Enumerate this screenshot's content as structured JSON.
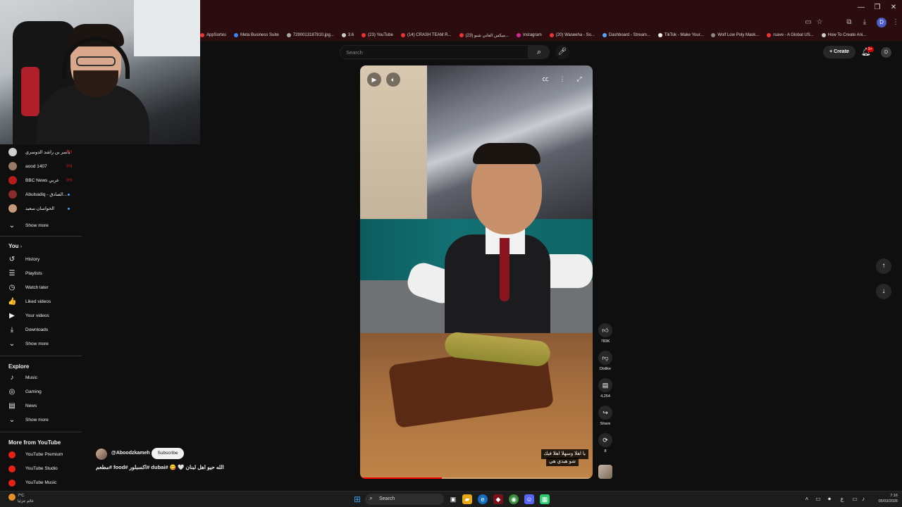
{
  "browser": {
    "bookmarks": [
      {
        "label": "AppSortes",
        "color": "#e33"
      },
      {
        "label": "Meta Business Suite",
        "color": "#3b82f6"
      },
      {
        "label": "7290013187810.jpg...",
        "color": "#aaa"
      },
      {
        "label": "3.6",
        "color": "#ccc"
      },
      {
        "label": "(23) YouTube",
        "color": "#e33"
      },
      {
        "label": "(14) CRASH TEAM R...",
        "color": "#e33"
      },
      {
        "label": "(23) ميكس العاني شبو...",
        "color": "#e33"
      },
      {
        "label": "Instagram",
        "color": "#d6249f"
      },
      {
        "label": "(20) Waseeha - So...",
        "color": "#e33"
      },
      {
        "label": "Dashboard - Stream...",
        "color": "#53a6ff"
      },
      {
        "label": "TikTok - Make Your...",
        "color": "#eee"
      },
      {
        "label": "Wolf Low Poly Mask...",
        "color": "#888"
      },
      {
        "label": "rsave - A Global US...",
        "color": "#e33"
      },
      {
        "label": "How To Create Ani...",
        "color": "#ccc"
      }
    ],
    "account_initial": "D"
  },
  "sidebar": {
    "subscriptions": [
      {
        "name": "ياسر بن راشد الدوسري",
        "status": "live",
        "live_text": "((•))",
        "avatar": "#d0d0d0"
      },
      {
        "name": "aood 1407",
        "status": "live",
        "live_text": "((•))",
        "avatar": "#9a7a66"
      },
      {
        "name": "BBC News عربي",
        "status": "live",
        "live_text": "((•))",
        "avatar": "#b71c1c"
      },
      {
        "name": "Abulsadiq - الصادق...",
        "status": "new",
        "live_text": "",
        "avatar": "#8a2a2a"
      },
      {
        "name": "الحواسان سعيد",
        "status": "new",
        "live_text": "",
        "avatar": "#c49a7a"
      }
    ],
    "show_more": "Show more",
    "you_heading": "You",
    "you_items": [
      {
        "label": "History",
        "icon": "history-icon",
        "glyph": "↺"
      },
      {
        "label": "Playlists",
        "icon": "playlists-icon",
        "glyph": "☰"
      },
      {
        "label": "Watch later",
        "icon": "watch-later-icon",
        "glyph": "◷"
      },
      {
        "label": "Liked videos",
        "icon": "like-icon",
        "glyph": "👍"
      },
      {
        "label": "Your videos",
        "icon": "your-videos-icon",
        "glyph": "▶"
      },
      {
        "label": "Downloads",
        "icon": "download-icon",
        "glyph": "⤓"
      }
    ],
    "explore_heading": "Explore",
    "explore_items": [
      {
        "label": "Music",
        "icon": "music-icon",
        "glyph": "♪"
      },
      {
        "label": "Gaming",
        "icon": "gaming-icon",
        "glyph": "◎"
      },
      {
        "label": "News",
        "icon": "news-icon",
        "glyph": "▤"
      }
    ],
    "more_heading": "More from YouTube",
    "more_items": [
      {
        "label": "YouTube Premium"
      },
      {
        "label": "YouTube Studio"
      },
      {
        "label": "YouTube Music"
      }
    ]
  },
  "topnav": {
    "search_placeholder": "Search",
    "create_label": "Create",
    "notif_count": "9+"
  },
  "short": {
    "channel": "@Aboodzkameh",
    "subscribe_label": "Subscribe",
    "title": "الله حيو اهل لبنان 🤍 😋 #dubai #اكسبلور #food #مطعم",
    "caption_line1": "يا اهلا وسهلا اهلا فيك",
    "caption_line2": "شو هيدي هي",
    "progress": 0.35,
    "likes": "783K",
    "dislike_label": "Dislike",
    "comments": "4,254",
    "share_label": "Share",
    "remix_count": "8"
  },
  "taskbar": {
    "weather_temp": "7°C",
    "weather_desc": "غائم جزئيا",
    "search_label": "Search",
    "lang": "ع",
    "time": "7:16",
    "date": "05/03/2026"
  }
}
